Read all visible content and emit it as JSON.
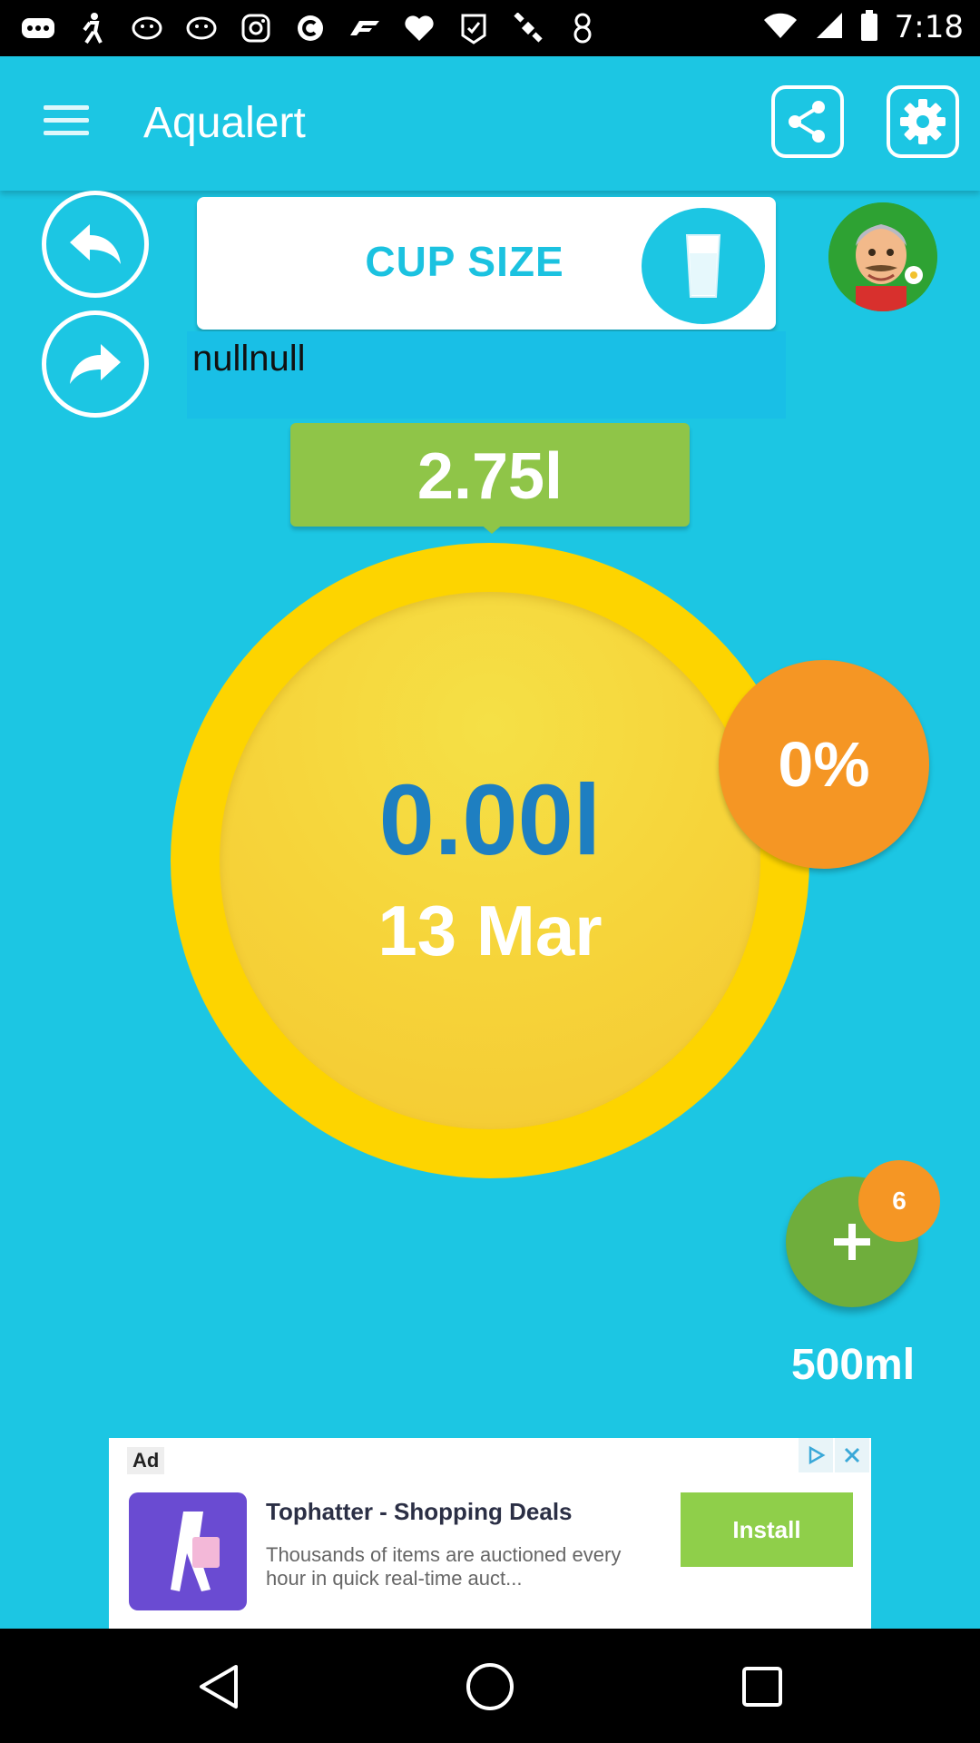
{
  "status_bar": {
    "time": "7:18",
    "icons": [
      "more-icon",
      "walk-icon",
      "pig-icon",
      "pig-icon",
      "instagram-icon",
      "c-icon",
      "f1-icon",
      "heart-icon",
      "fake-gps-icon",
      "satellite-icon",
      "figure-8-icon",
      "wifi-icon",
      "signal-icon",
      "battery-icon"
    ]
  },
  "app_bar": {
    "title": "Aqualert"
  },
  "cup_size": {
    "label": "CUP SIZE"
  },
  "user": {
    "name": "nullnull"
  },
  "goal": {
    "value": "2.75l"
  },
  "progress": {
    "consumed": "0.00l",
    "date": "13 Mar",
    "percent_text": "0%",
    "percent_fraction": 0
  },
  "add": {
    "count": "6",
    "amount": "500ml"
  },
  "ad": {
    "label": "Ad",
    "title": "Tophatter - Shopping Deals",
    "description": "Thousands of items are auctioned every hour in quick real-time auct...",
    "button": "Install"
  },
  "colors": {
    "background": "#1cc6e3",
    "goal_green": "#8fc548",
    "ring_yellow": "#fdd400",
    "percent_orange": "#f59624",
    "consumed_blue": "#1e7fc1",
    "add_green": "#6fae3c"
  }
}
